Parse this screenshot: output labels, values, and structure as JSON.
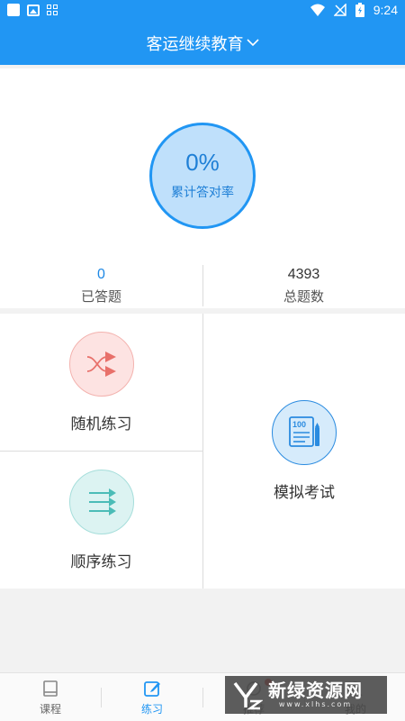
{
  "statusbar": {
    "time": "9:24"
  },
  "header": {
    "title": "客运继续教育"
  },
  "progress": {
    "percent_text": "0%",
    "label": "累计答对率"
  },
  "stats": {
    "answered": {
      "value": "0",
      "label": "已答题"
    },
    "total": {
      "value": "4393",
      "label": "总题数"
    }
  },
  "modes": {
    "random": {
      "label": "随机练习",
      "icon": "shuffle-icon"
    },
    "sequential": {
      "label": "顺序练习",
      "icon": "sequence-icon"
    },
    "mock": {
      "label": "模拟考试",
      "icon": "exam-paper-icon",
      "badge": "100"
    }
  },
  "tabs": [
    {
      "label": "课程",
      "icon": "book-icon"
    },
    {
      "label": "练习",
      "icon": "edit-icon",
      "active": true
    },
    {
      "label": "推荐",
      "icon": "recommend-icon",
      "has_dot": true
    },
    {
      "label": "我的",
      "icon": "profile-icon"
    }
  ],
  "watermark": {
    "text": "新绿资源网",
    "url": "www.xlhs.com"
  },
  "colors": {
    "primary": "#2196f3",
    "ring_fill": "#bfe0fb",
    "random_bg": "#fde3e2",
    "random_accent": "#e8706a",
    "sequential_bg": "#dcf3f2",
    "sequential_accent": "#4bbcb7",
    "mock_bg": "#d6ebfb",
    "mock_accent": "#2a8be0"
  }
}
